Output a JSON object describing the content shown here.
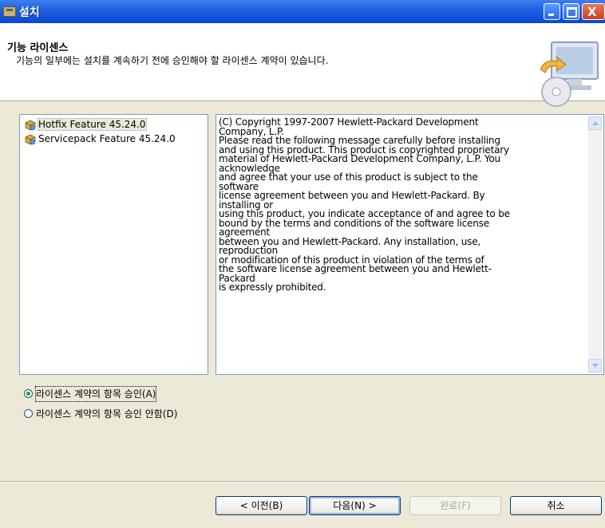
{
  "window": {
    "title": "설치"
  },
  "banner": {
    "heading": "기능 라이센스",
    "description": "기능의 일부에는 설치를 계속하기 전에 승인해야 할 라이센스 계약이 있습니다."
  },
  "features": [
    {
      "label": "Hotfix Feature 45.24.0",
      "selected": true
    },
    {
      "label": "Servicepack Feature 45.24.0",
      "selected": false
    }
  ],
  "license": {
    "lines": [
      "(C) Copyright 1997-2007 Hewlett-Packard Development",
      "Company, L.P.",
      "Please read the following message carefully before installing",
      "and using this product. This product is copyrighted proprietary",
      "material of Hewlett-Packard Development Company, L.P. You",
      "acknowledge",
      "and agree that your use of this product is subject to the",
      "software",
      "license agreement between you and Hewlett-Packard. By",
      "installing or",
      "using this product, you indicate acceptance of and agree to be",
      "bound by the terms and conditions of the software license",
      "agreement",
      "between you and Hewlett-Packard. Any installation, use,",
      "reproduction",
      "or modification of this product in violation of the terms of",
      "the software license agreement between you and Hewlett-",
      "Packard",
      "is expressly prohibited."
    ]
  },
  "options": {
    "accept_label": "라이센스 계약의 항목 승인(A)",
    "decline_label": "라이센스 계약의 항목 승인 안함(D)",
    "selected": "accept"
  },
  "buttons": {
    "back": "< 이전(B)",
    "next": "다음(N) >",
    "finish": "완료(F)",
    "cancel": "취소"
  },
  "colors": {
    "title_bar": "#0a47d4",
    "dialog_bg": "#ece9d8",
    "radio_checked": "#21a121"
  }
}
